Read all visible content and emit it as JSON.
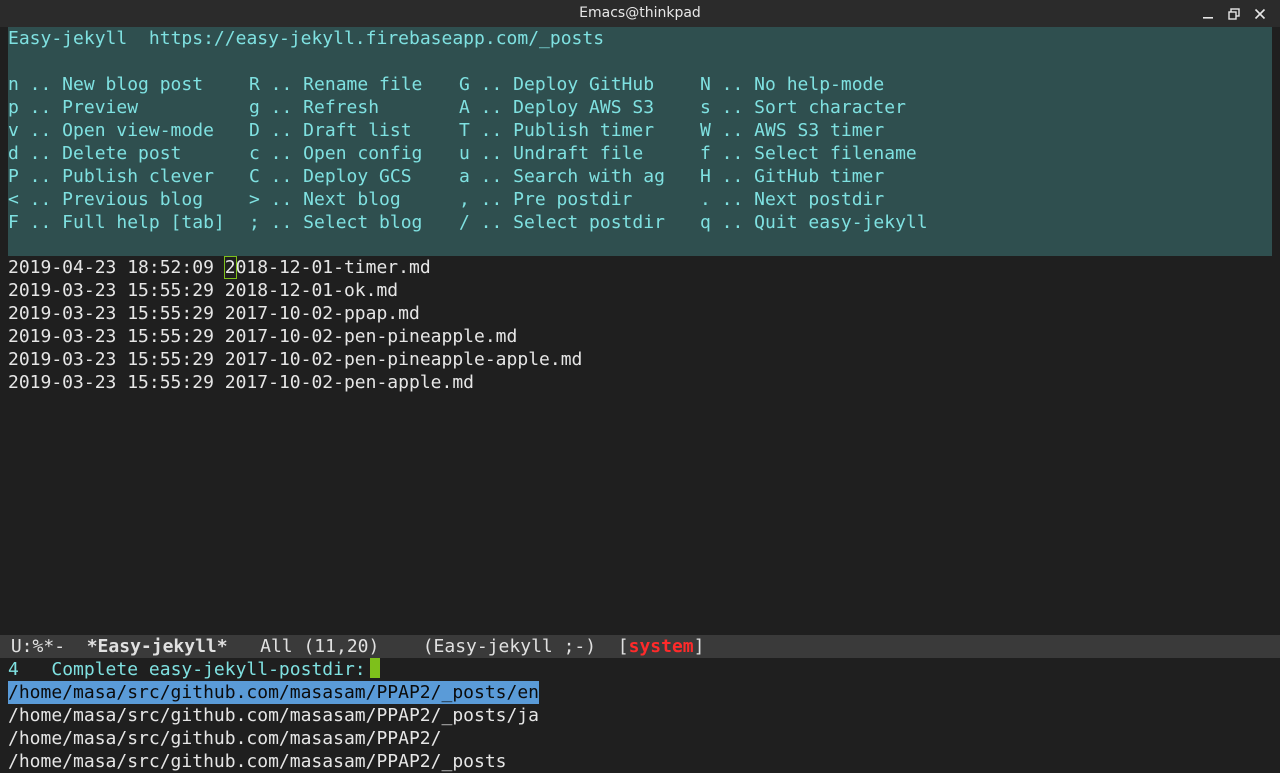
{
  "window": {
    "title": "Emacs@thinkpad",
    "controls": [
      "minimize",
      "maximize",
      "close"
    ]
  },
  "help": {
    "header_name": "Easy-jekyll",
    "header_url": "https://easy-jekyll.firebaseapp.com/_posts",
    "rows": [
      [
        "n .. New blog post",
        "R .. Rename file",
        "G .. Deploy GitHub",
        "N .. No help-mode"
      ],
      [
        "p .. Preview",
        "g .. Refresh",
        "A .. Deploy AWS S3",
        "s .. Sort character"
      ],
      [
        "v .. Open view-mode",
        "D .. Draft list",
        "T .. Publish timer",
        "W .. AWS S3 timer"
      ],
      [
        "d .. Delete post",
        "c .. Open config",
        "u .. Undraft file",
        "f .. Select filename"
      ],
      [
        "P .. Publish clever",
        "C .. Deploy GCS",
        "a .. Search with ag",
        "H .. GitHub timer"
      ],
      [
        "< .. Previous blog",
        "> .. Next blog",
        ", .. Pre postdir",
        ". .. Next postdir"
      ],
      [
        "F .. Full help [tab]",
        "; .. Select blog",
        "/ .. Select postdir",
        "q .. Quit easy-jekyll"
      ]
    ]
  },
  "files": [
    {
      "timestamp": "2019-04-23 18:52:09",
      "name_first": "2",
      "name_rest": "018-12-01-timer.md"
    },
    {
      "timestamp": "2019-03-23 15:55:29",
      "name_first": "2",
      "name_rest": "018-12-01-ok.md"
    },
    {
      "timestamp": "2019-03-23 15:55:29",
      "name_first": "2",
      "name_rest": "017-10-02-ppap.md"
    },
    {
      "timestamp": "2019-03-23 15:55:29",
      "name_first": "2",
      "name_rest": "017-10-02-pen-pineapple.md"
    },
    {
      "timestamp": "2019-03-23 15:55:29",
      "name_first": "2",
      "name_rest": "017-10-02-pen-pineapple-apple.md"
    },
    {
      "timestamp": "2019-03-23 15:55:29",
      "name_first": "2",
      "name_rest": "017-10-02-pen-apple.md"
    }
  ],
  "modeline": {
    "status": "U:%*-",
    "buffer": "*Easy-jekyll*",
    "position": "All (11,20)",
    "mode_open": "(Easy-jekyll ;-)",
    "bracket_open": "[",
    "system": "system",
    "bracket_close": "]"
  },
  "minibuffer": {
    "count": "4",
    "prompt": "Complete easy-jekyll-postdir:",
    "candidates": [
      "/home/masa/src/github.com/masasam/PPAP2/_posts/en",
      "/home/masa/src/github.com/masasam/PPAP2/_posts/ja",
      "/home/masa/src/github.com/masasam/PPAP2/",
      "/home/masa/src/github.com/masasam/PPAP2/_posts"
    ],
    "selected_index": 0
  },
  "colors": {
    "help_bg": "#2f4f4f",
    "help_fg": "#7fe1e1",
    "selection": "#5a9bd8",
    "cursor": "#7ec01b",
    "system": "#ff2a2a"
  }
}
